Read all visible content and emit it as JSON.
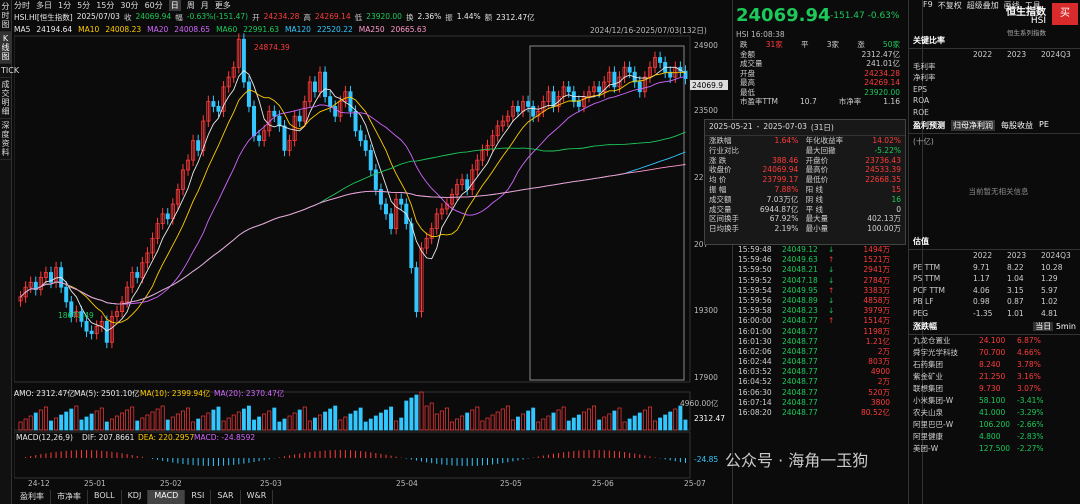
{
  "sidebar_tabs": [
    "分时图",
    "K线图",
    "TICK",
    "成交明细",
    "深度资料"
  ],
  "toolbar": {
    "items": [
      "分时",
      "多日",
      "1分",
      "5分",
      "15分",
      "30分",
      "60分",
      "日",
      "周",
      "月",
      "更多"
    ],
    "active": "日",
    "right": [
      "F9",
      "不复权",
      "超级叠加",
      "画线",
      "工具"
    ]
  },
  "quote_line": {
    "name": "HSI.HI[恒生指数]",
    "date": "2025/07/03",
    "close_label": "收",
    "close": "24069.94",
    "chg_label": "幅",
    "chg": "-0.63%(-151.47)",
    "open_label": "开",
    "open": "24234.28",
    "high_label": "高",
    "high": "24269.14",
    "low_label": "低",
    "low": "23920.00",
    "turnover_label": "换",
    "turnover": "2.36%",
    "amp_label": "振",
    "amp": "1.44%",
    "amount_label": "额",
    "amount": "2312.47亿"
  },
  "ma_legend": [
    {
      "k": "MA5",
      "v": "24194.64",
      "color": "#eaeaea"
    },
    {
      "k": "MA10",
      "v": "24008.23",
      "color": "#ffcc00"
    },
    {
      "k": "MA20",
      "v": "24008.65",
      "color": "#d266ff"
    },
    {
      "k": "MA60",
      "v": "22991.63",
      "color": "#1dc95a"
    },
    {
      "k": "MA120",
      "v": "22520.22",
      "color": "#32c8ff"
    },
    {
      "k": "MA250",
      "v": "20665.63",
      "color": "#ff99cc"
    }
  ],
  "price_axis": [
    "24900",
    "23500",
    "221",
    "207",
    "19300",
    "17900"
  ],
  "high_marker": "24874.39",
  "low_marker": "18671.49",
  "last_price_tag": "24069.9",
  "range_label": "2024/12/16-2025/07/03(132日)",
  "volume_legend": {
    "amo": "AMO: 2312.47亿",
    "ma5": "MA(5): 2501.10亿",
    "ma10": "MA(10): 2399.94亿",
    "ma20": "MA(20): 2370.47亿",
    "axis_top": "4960.00亿",
    "tag": "2312.47"
  },
  "macd_legend": {
    "name": "MACD(12,26,9)",
    "dif": "DIF: 207.8661",
    "dea": "DEA: 220.2957",
    "macd": "MACD: -24.8592",
    "tag": "-24.85"
  },
  "date_axis": [
    "24-12",
    "25-01",
    "25-02",
    "25-03",
    "25-04",
    "25-05",
    "25-06",
    "25-07"
  ],
  "bottom_tabs": [
    "盈利率",
    "市净率",
    "BOLL",
    "KDJ",
    "MACD",
    "RSI",
    "SAR",
    "W&R"
  ],
  "bottom_active": "MACD",
  "header": {
    "price": "24069.94",
    "chg": "-151.47",
    "pct": "-0.63%",
    "code": "HSI",
    "time": "16:08:38",
    "up": "31家",
    "flat_label": "平",
    "flat": "3家",
    "down_label": "跌",
    "down": "50家",
    "up_label": "涨",
    "title": "恒生指数",
    "title_code": "HSI",
    "buy": "买",
    "series": "恒生系列指数"
  },
  "stats": [
    {
      "k": "金额",
      "v": "2312.47亿"
    },
    {
      "k": "成交量",
      "v": "241.01亿"
    },
    {
      "k": "开盘",
      "v": "24234.28",
      "c": "r"
    },
    {
      "k": "最高",
      "v": "24269.14",
      "c": "r"
    },
    {
      "k": "最低",
      "v": "23920.00",
      "c": "g"
    },
    {
      "k": "市盈率TTM",
      "v": "10.7",
      "k2": "市净率",
      "v2": "1.16"
    }
  ],
  "popup": {
    "from": "2025-05-21",
    "to": "2025-07-03",
    "days": "(31日)",
    "rows": [
      {
        "k": "涨跌幅",
        "v": "1.64%",
        "k2": "年化收益率",
        "v2": "14.02%",
        "c": "r",
        "c2": "r"
      },
      {
        "k": "行业对比",
        "v": "",
        "k2": "最大回撤",
        "v2": "-5.22%",
        "c2": "g"
      },
      {
        "k": "涨 跌",
        "v": "388.46",
        "k2": "开盘价",
        "v2": "23736.43",
        "c": "r",
        "c2": "r"
      },
      {
        "k": "收盘价",
        "v": "24069.94",
        "k2": "最高价",
        "v2": "24533.39",
        "c": "r",
        "c2": "r"
      },
      {
        "k": "均 价",
        "v": "23799.17",
        "k2": "最低价",
        "v2": "22668.35",
        "c": "r",
        "c2": "r"
      },
      {
        "k": "振 幅",
        "v": "7.88%",
        "k2": "阳 线",
        "v2": "15",
        "c": "r",
        "c2": "r"
      },
      {
        "k": "成交额",
        "v": "7.03万亿",
        "k2": "阴 线",
        "v2": "16",
        "c2": "g"
      },
      {
        "k": "成交量",
        "v": "6944.87亿",
        "k2": "平 线",
        "v2": "0"
      },
      {
        "k": "区间换手",
        "v": "67.92%",
        "k2": "最大量",
        "v2": "402.13万"
      },
      {
        "k": "日均换手",
        "v": "2.19%",
        "k2": "最小量",
        "v2": "100.00万"
      }
    ]
  },
  "ticks": [
    {
      "t": "15:59:48",
      "p": "24049.12",
      "a": "↓",
      "v": "1494万"
    },
    {
      "t": "15:59:46",
      "p": "24049.63",
      "a": "↑",
      "v": "1521万"
    },
    {
      "t": "15:59:50",
      "p": "24048.21",
      "a": "↓",
      "v": "2941万"
    },
    {
      "t": "15:59:52",
      "p": "24047.18",
      "a": "↓",
      "v": "2784万"
    },
    {
      "t": "15:59:54",
      "p": "24049.95",
      "a": "↑",
      "v": "3383万"
    },
    {
      "t": "15:59:56",
      "p": "24048.89",
      "a": "↓",
      "v": "4858万"
    },
    {
      "t": "15:59:58",
      "p": "24048.23",
      "a": "↓",
      "v": "3979万"
    },
    {
      "t": "16:00:00",
      "p": "24048.77",
      "a": "↑",
      "v": "1514万"
    },
    {
      "t": "16:01:00",
      "p": "24048.77",
      "a": "",
      "v": "1198万"
    },
    {
      "t": "16:01:30",
      "p": "24048.77",
      "a": "",
      "v": "1.21亿"
    },
    {
      "t": "16:02:06",
      "p": "24048.77",
      "a": "",
      "v": "2万"
    },
    {
      "t": "16:02:44",
      "p": "24048.77",
      "a": "",
      "v": "803万"
    },
    {
      "t": "16:03:52",
      "p": "24048.77",
      "a": "",
      "v": "4900"
    },
    {
      "t": "16:04:52",
      "p": "24048.77",
      "a": "",
      "v": "2万"
    },
    {
      "t": "16:06:30",
      "p": "24048.77",
      "a": "",
      "v": "520万"
    },
    {
      "t": "16:07:14",
      "p": "24048.77",
      "a": "",
      "v": "3800"
    },
    {
      "t": "16:08:20",
      "p": "24048.77",
      "a": "",
      "v": "80.52亿"
    }
  ],
  "ratios": {
    "title": "关键比率",
    "years": [
      "2022",
      "2023",
      "2024Q3"
    ],
    "rows": [
      "毛利率",
      "净利率",
      "EPS",
      "ROA",
      "ROE"
    ]
  },
  "forecast": {
    "title": "盈利预测",
    "tabs": [
      "归母净利润",
      "每股收益",
      "PE"
    ],
    "unit": "(十亿)",
    "empty": "当前暂无相关信息"
  },
  "valuation": {
    "title": "估值",
    "years": [
      "2022",
      "2023",
      "2024Q3"
    ],
    "rows": [
      {
        "k": "PE TTM",
        "v": [
          "9.71",
          "8.22",
          "10.28"
        ]
      },
      {
        "k": "PS TTM",
        "v": [
          "1.17",
          "1.04",
          "1.29"
        ]
      },
      {
        "k": "PCF TTM",
        "v": [
          "4.06",
          "3.15",
          "5.97"
        ]
      },
      {
        "k": "PB LF",
        "v": [
          "0.98",
          "0.87",
          "1.02"
        ]
      },
      {
        "k": "PEG",
        "v": [
          "-1.35",
          "1.01",
          "4.81"
        ]
      }
    ]
  },
  "movers": {
    "title": "涨跌幅",
    "tabs": [
      "当日",
      "5min"
    ],
    "rows": [
      {
        "n": "九龙仓置业",
        "p": "24.100",
        "c": "6.87%",
        "s": "r"
      },
      {
        "n": "舜宇光学科技",
        "p": "70.700",
        "c": "4.66%",
        "s": "r"
      },
      {
        "n": "石药集团",
        "p": "8.240",
        "c": "3.78%",
        "s": "r"
      },
      {
        "n": "紫金矿业",
        "p": "21.250",
        "c": "3.16%",
        "s": "r"
      },
      {
        "n": "联想集团",
        "p": "9.730",
        "c": "3.07%",
        "s": "r"
      },
      {
        "n": "小米集团-W",
        "p": "58.100",
        "c": "-3.41%",
        "s": "g"
      },
      {
        "n": "农夫山泉",
        "p": "41.000",
        "c": "-3.29%",
        "s": "g"
      },
      {
        "n": "阿里巴巴-W",
        "p": "106.200",
        "c": "-2.66%",
        "s": "g"
      },
      {
        "n": "阿里健康",
        "p": "4.800",
        "c": "-2.83%",
        "s": "g"
      },
      {
        "n": "美团-W",
        "p": "127.500",
        "c": "-2.27%",
        "s": "g"
      }
    ]
  },
  "watermark": "公众号 · 海角一玉狗",
  "chart_data": {
    "type": "candlestick",
    "title": "HSI.HI[恒生指数]",
    "x_range": [
      "2024-12-16",
      "2025-07-03"
    ],
    "ylim": [
      17900,
      24900
    ],
    "closes": [
      19600,
      19800,
      19900,
      19750,
      20000,
      20100,
      19900,
      20200,
      19800,
      19500,
      19200,
      19300,
      19100,
      18900,
      18850,
      19000,
      19100,
      18671,
      19200,
      19300,
      19500,
      19800,
      20100,
      20000,
      20300,
      20500,
      20800,
      21100,
      21300,
      21200,
      21500,
      21800,
      22200,
      22400,
      22800,
      22600,
      23200,
      23600,
      23500,
      23400,
      23900,
      24100,
      24300,
      24874,
      24000,
      23500,
      22900,
      22800,
      23000,
      23400,
      23300,
      23100,
      22600,
      22800,
      23300,
      23200,
      23600,
      24000,
      23800,
      24200,
      23700,
      23500,
      23300,
      23600,
      23800,
      23400,
      23000,
      22800,
      22600,
      22200,
      21800,
      21500,
      21300,
      21000,
      21600,
      21500,
      21100,
      20200,
      19300,
      20600,
      20800,
      21000,
      21300,
      21400,
      21500,
      21700,
      21900,
      22000,
      21800,
      22200,
      22400,
      22600,
      22700,
      22900,
      23100,
      23200,
      23300,
      23500,
      23400,
      23600,
      23500,
      23300,
      23400,
      23600,
      23800,
      23500,
      23700,
      23900,
      23800,
      23600,
      23500,
      23700,
      23800,
      23900,
      23800,
      24000,
      24200,
      23900,
      24100,
      24300,
      24200,
      24000,
      23800,
      24100,
      24300,
      24500,
      24400,
      24200,
      24100,
      24300,
      24221,
      24070
    ]
  }
}
